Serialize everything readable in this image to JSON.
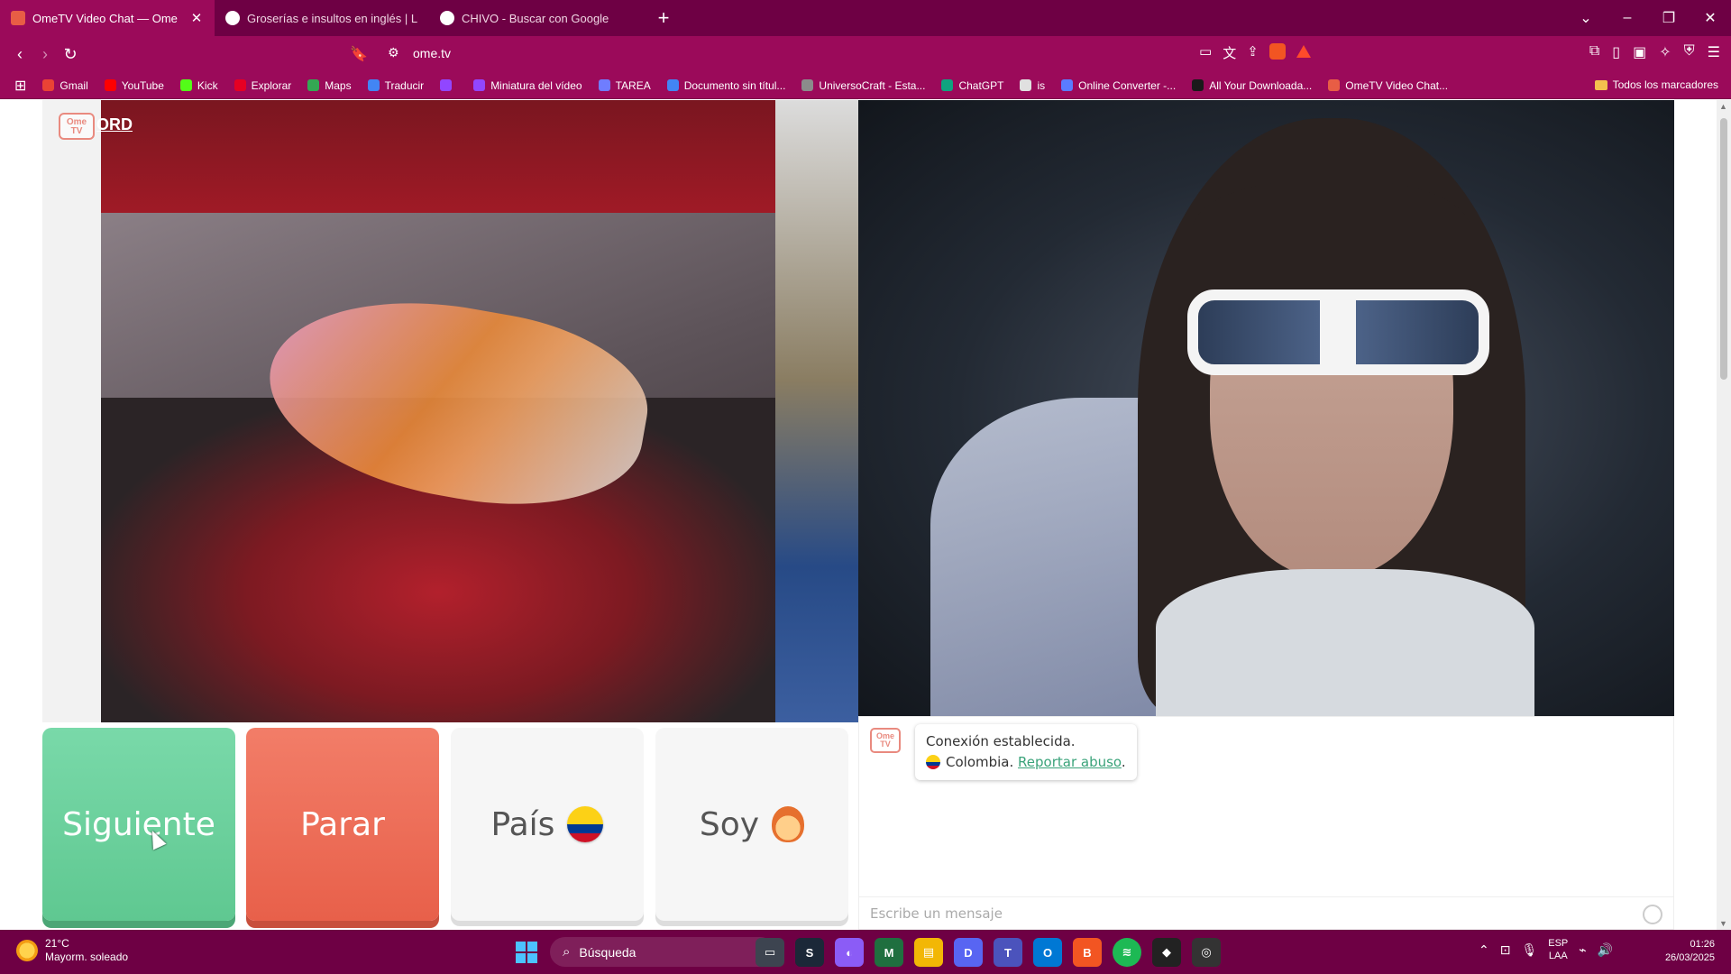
{
  "browser": {
    "tabs": [
      {
        "title": "OmeTV Video Chat — Ome",
        "active": true
      },
      {
        "title": "Groserías e insultos en inglés | Ling",
        "active": false
      },
      {
        "title": "CHIVO - Buscar con Google",
        "active": false
      }
    ],
    "new_tab": "+",
    "url": "ome.tv",
    "bookmarks": [
      {
        "label": "Gmail",
        "color": "#ea4335"
      },
      {
        "label": "YouTube",
        "color": "#ff0000"
      },
      {
        "label": "Kick",
        "color": "#53fc18"
      },
      {
        "label": "Explorar",
        "color": "#e60023"
      },
      {
        "label": "Maps",
        "color": "#34a853"
      },
      {
        "label": "Traducir",
        "color": "#4285f4"
      },
      {
        "label": "",
        "color": "#9146ff"
      },
      {
        "label": "Miniatura del vídeo",
        "color": "#9146ff"
      },
      {
        "label": "TAREA",
        "color": "#6f7dff"
      },
      {
        "label": "Documento sin títul...",
        "color": "#4285f4"
      },
      {
        "label": "UniversoCraft - Esta...",
        "color": "#8b8b8b"
      },
      {
        "label": "ChatGPT",
        "color": "#10a37f"
      },
      {
        "label": "is",
        "color": "#e0e0e0"
      },
      {
        "label": "Online Converter -...",
        "color": "#5a7cff"
      },
      {
        "label": "All Your Downloada...",
        "color": "#1a1a1a"
      },
      {
        "label": "OmeTV Video Chat...",
        "color": "#e85d45"
      }
    ],
    "all_bookmarks": "Todos los marcadores"
  },
  "page": {
    "logo_text": "Ome\nTV",
    "overlay_text": "ORD",
    "buttons": {
      "next": "Siguiente",
      "stop": "Parar",
      "country": "País",
      "gender": "Soy"
    },
    "chat": {
      "status": "Conexión establecida.",
      "country": "Colombia.",
      "report": "Reportar abuso",
      "report_suffix": ".",
      "input_placeholder": "Escribe un mensaje"
    },
    "colors": {
      "next": "#6ccf9d",
      "stop": "#ec6b55",
      "accent_link": "#3aa37a"
    }
  },
  "taskbar": {
    "weather_temp": "21°C",
    "weather_desc": "Mayorm. soleado",
    "search": "Búsqueda",
    "lang_top": "ESP",
    "lang_bottom": "LAA",
    "time": "01:26",
    "date": "26/03/2025"
  }
}
